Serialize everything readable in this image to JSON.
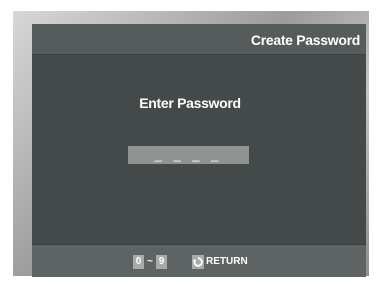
{
  "header": {
    "title": "Create Password"
  },
  "main": {
    "prompt": "Enter Password",
    "password_field_value": "_ _ _ _"
  },
  "footer": {
    "digit_start": "0",
    "range_separator": "~",
    "digit_end": "9",
    "return_label": "RETURN",
    "return_icon": "return-arrow-icon"
  },
  "colors": {
    "screen_bg": "#434a49",
    "title_bar_bg": "#555c5b",
    "footer_bg": "#5e6463",
    "field_bg": "#8f9493",
    "key_bg": "#a7acab",
    "text": "#ffffff"
  }
}
